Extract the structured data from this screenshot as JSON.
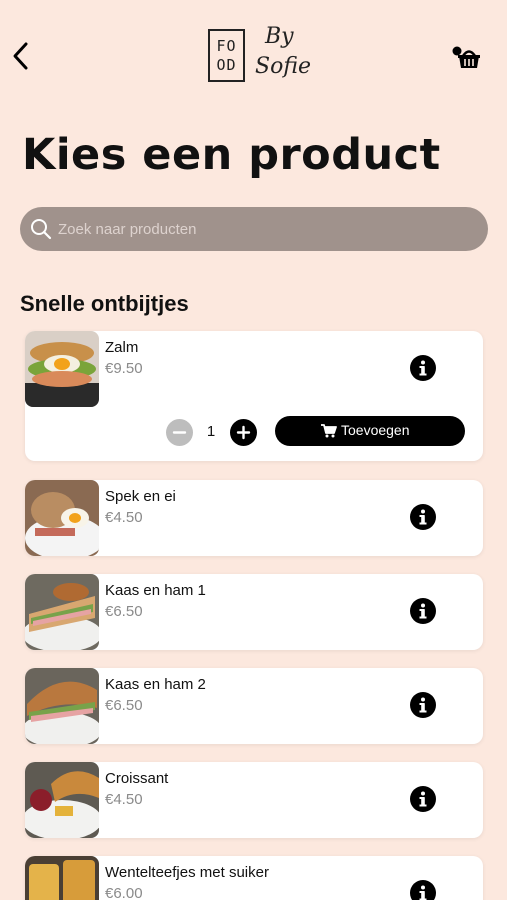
{
  "header": {
    "logo_line1": "FO",
    "logo_line2": "OD",
    "logo_by": "By",
    "logo_name": "Sofie"
  },
  "page": {
    "title": "Kies een product"
  },
  "search": {
    "placeholder": "Zoek naar producten"
  },
  "section": {
    "title": "Snelle ontbijtjes"
  },
  "expanded": {
    "quantity": "1",
    "add_label": "Toevoegen"
  },
  "products": [
    {
      "name": "Zalm",
      "price": "€9.50"
    },
    {
      "name": "Spek en ei",
      "price": "€4.50"
    },
    {
      "name": "Kaas en ham 1",
      "price": "€6.50"
    },
    {
      "name": "Kaas en ham 2",
      "price": "€6.50"
    },
    {
      "name": "Croissant",
      "price": "€4.50"
    },
    {
      "name": "Wentelteefjes met suiker",
      "price": "€6.00"
    }
  ],
  "colors": {
    "background": "#fce8de",
    "search_bg": "#a0928c",
    "card_bg": "#ffffff",
    "button_bg": "#000000",
    "minus_bg": "#bdbdbd",
    "price": "#8a8a8a"
  },
  "icons": {
    "back": "back-arrow-icon",
    "cart": "shopping-basket-icon",
    "search": "search-icon",
    "info": "info-icon",
    "minus": "minus-icon",
    "plus": "plus-icon",
    "add": "cart-icon"
  }
}
